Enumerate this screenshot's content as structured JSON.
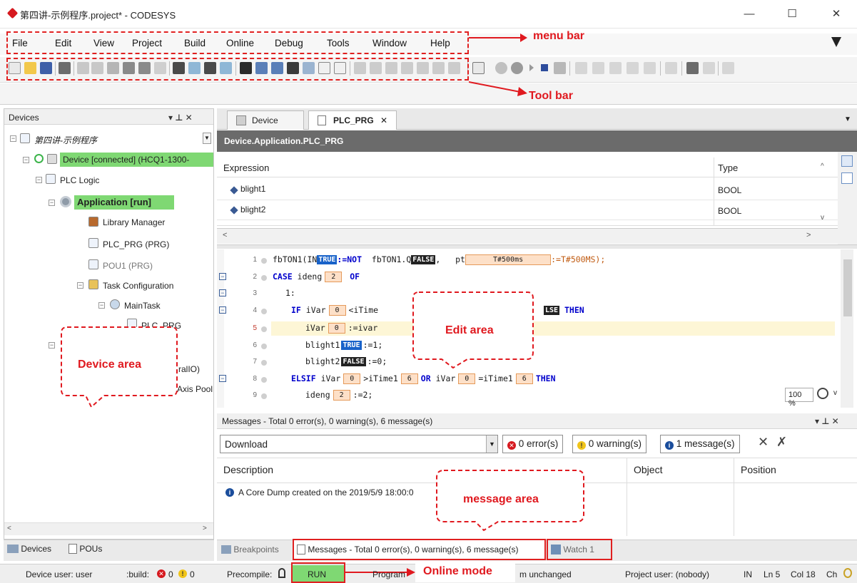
{
  "window": {
    "title": "第四讲-示例程序.project* - CODESYS",
    "minimize": "—",
    "maximize": "☐",
    "close": "✕"
  },
  "menu": [
    "File",
    "Edit",
    "View",
    "Project",
    "Build",
    "Online",
    "Debug",
    "Tools",
    "Window",
    "Help"
  ],
  "annotations": {
    "menu_bar": "menu bar",
    "tool_bar": "Tool bar",
    "device_area": "Device area",
    "edit_area": "Edit area",
    "message_area": "message area",
    "online_mode": "Online mode"
  },
  "devices_panel": {
    "title": "Devices",
    "controls": "▾ ⊥ ✕",
    "tree": [
      {
        "label": "第四讲-示例程序",
        "indent": 0
      },
      {
        "label": "Device [connected] (HCQ1-1300-",
        "indent": 1
      },
      {
        "label": "PLC Logic",
        "indent": 2
      },
      {
        "label": "Application [run]",
        "indent": 3
      },
      {
        "label": "Library Manager",
        "indent": 4
      },
      {
        "label": "PLC_PRG (PRG)",
        "indent": 4
      },
      {
        "label": "POU1 (PRG)",
        "indent": 4
      },
      {
        "label": "Task Configuration",
        "indent": 4
      },
      {
        "label": "MainTask",
        "indent": 5
      },
      {
        "label": "PLC_PRG",
        "indent": 6
      },
      {
        "label": "ralIO)",
        "indent": 6
      },
      {
        "label": "Axis Pool",
        "indent": 6
      }
    ],
    "bottom_tabs": [
      "Devices",
      "POUs"
    ]
  },
  "editor": {
    "tabs": [
      "Device",
      "PLC_PRG"
    ],
    "path": "Device.Application.PLC_PRG",
    "columns": {
      "expression": "Expression",
      "type": "Type"
    },
    "vars": [
      {
        "name": "blight1",
        "type": "BOOL"
      },
      {
        "name": "blight2",
        "type": "BOOL"
      }
    ],
    "zoom": "100 %",
    "code": [
      {
        "n": "1",
        "text": "fbTON1(IN|TRUE|:=NOT  fbTON1.Q|FALSE|,  pt|T#500ms|:=T#500MS);"
      },
      {
        "n": "2",
        "text": "CASE ideng|2|OF"
      },
      {
        "n": "3",
        "text": "1:"
      },
      {
        "n": "4",
        "text": "IF iVar|0|<iTime"
      },
      {
        "n": "5",
        "text": "iVar|0|:=ivar"
      },
      {
        "n": "6",
        "text": "blight1|TRUE|:=1;"
      },
      {
        "n": "7",
        "text": "blight2|FALSE|:=0;"
      },
      {
        "n": "8",
        "text": "ELSIF iVar|0|>iTime1|6|OR iVar|0|=iTime1|6|THEN"
      },
      {
        "n": "9",
        "text": "ideng|2|:=2;"
      }
    ],
    "line4_tail": "LSE THEN",
    "tokens": {
      "fbton": "fbTON1(IN",
      "not": ":=NOT",
      "q": "fbTON1.Q",
      "pt": "pt",
      "t500": "T#500ms",
      "t500b": ":=T#500MS);",
      "case": "CASE",
      "ideng": "ideng",
      "two": "2",
      "of": "OF",
      "one": "1:",
      "if": "IF",
      "ivar": "iVar",
      "zero": "0",
      "ltitime": "<iTime",
      "assign_ivar": ":=ivar",
      "blight1": "blight1",
      "true": "TRUE",
      "false": "FALSE",
      "assign1": ":=1;",
      "blight2": "blight2",
      "assign0": ":=0;",
      "elsif": "ELSIF",
      "gt": ">iTime1",
      "six": "6",
      "or": "OR",
      "eq": "=iTime1",
      "then": "THEN",
      "assign2": ":=2;",
      "lse": "LSE",
      "comma": ",",
      "paren": ""
    }
  },
  "messages": {
    "header": "Messages - Total 0 error(s), 0 warning(s), 6 message(s)",
    "combo": "Download",
    "errors": "0 error(s)",
    "warnings": "0 warning(s)",
    "info": "1 message(s)",
    "columns": {
      "description": "Description",
      "object": "Object",
      "position": "Position"
    },
    "rows": [
      "A Core Dump created on the 2019/5/9 18:00:0"
    ]
  },
  "bottom_tabs": {
    "breakpoints": "Breakpoints",
    "messages": "Messages - Total 0 error(s), 0 warning(s), 6 message(s)",
    "watch": "Watch 1"
  },
  "status": {
    "device_user": "Device user: user",
    "build": ":build:",
    "build_err": "0",
    "build_warn": "0",
    "precompile": "Precompile:",
    "run": "RUN",
    "program": "Program",
    "unchanged": "m unchanged",
    "project_user": "Project user: (nobody)",
    "ins": "IN",
    "ln": "Ln 5",
    "col": "Col 18",
    "ch": "Ch"
  }
}
